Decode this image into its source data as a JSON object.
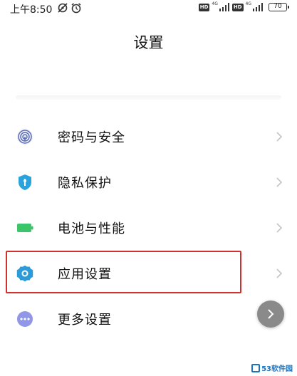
{
  "status_bar": {
    "time": "上午8:50",
    "network_1": "4G",
    "network_2": "4G",
    "hd_1": "HD",
    "hd_2": "HD",
    "battery": "70"
  },
  "header": {
    "title": "设置"
  },
  "settings": {
    "items": [
      {
        "label": "密码与安全",
        "icon": "fingerprint-icon",
        "color": "#5b6bb5"
      },
      {
        "label": "隐私保护",
        "icon": "shield-icon",
        "color": "#2aa3dd"
      },
      {
        "label": "电池与性能",
        "icon": "battery-icon",
        "color": "#3cc56a"
      },
      {
        "label": "应用设置",
        "icon": "gear-icon",
        "color": "#2d9bd8"
      },
      {
        "label": "更多设置",
        "icon": "more-dots-icon",
        "color": "#8f97e6"
      }
    ]
  },
  "annotation": {
    "highlight_color": "#d0312d"
  },
  "watermark": {
    "text": "53软件园"
  }
}
